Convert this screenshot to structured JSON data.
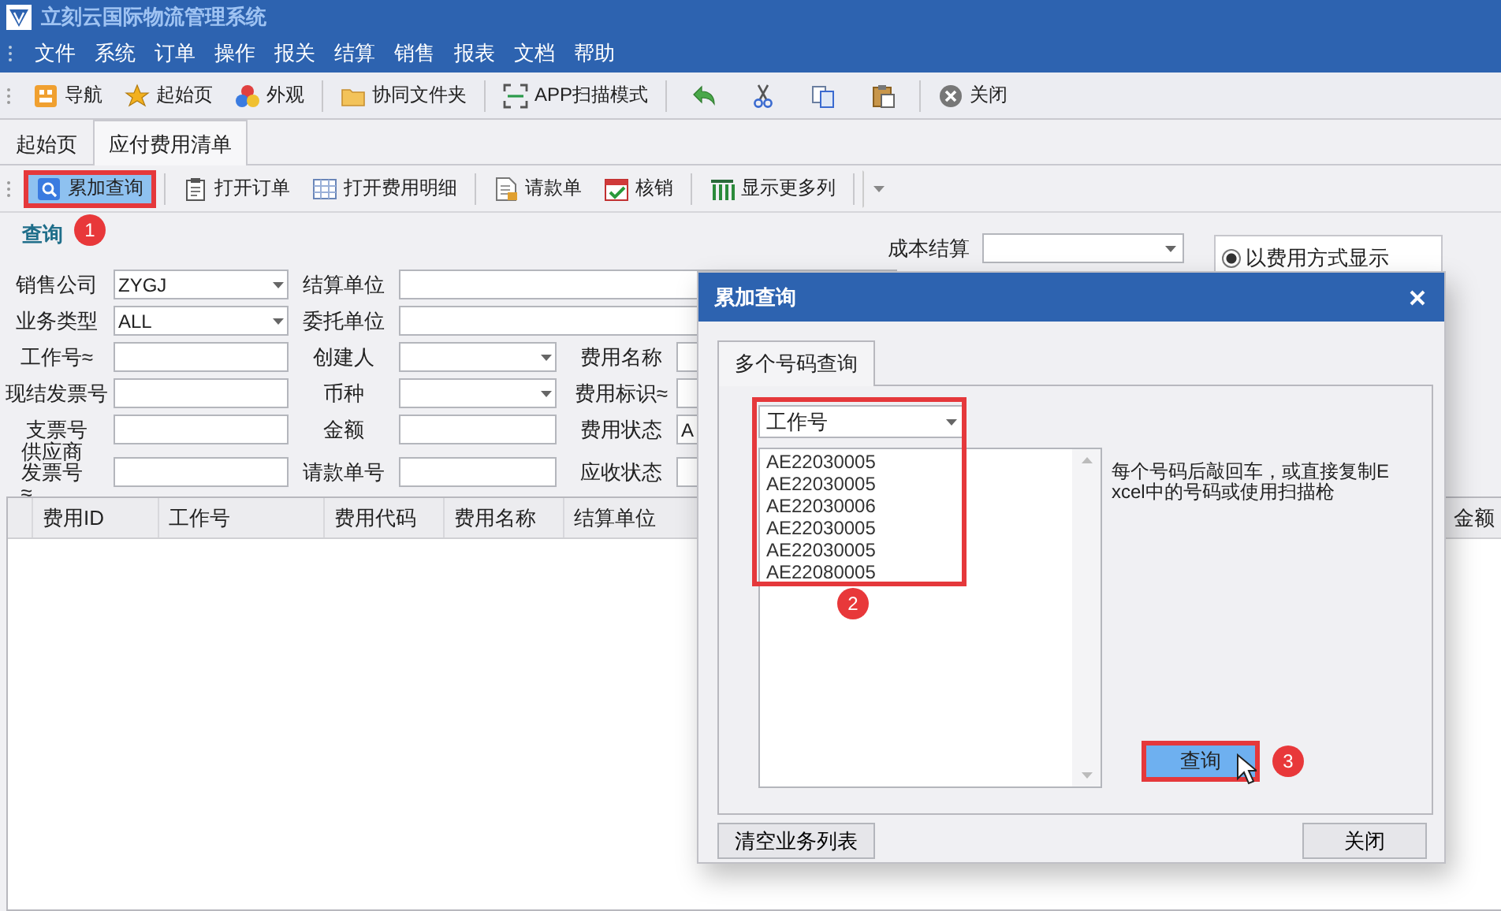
{
  "window": {
    "title": "立刻云国际物流管理系统"
  },
  "menu": [
    "文件",
    "系统",
    "订单",
    "操作",
    "报关",
    "结算",
    "销售",
    "报表",
    "文档",
    "帮助"
  ],
  "toolbar": [
    [
      {
        "kind": "labeled",
        "label": "导航"
      },
      {
        "kind": "labeled",
        "label": "起始页"
      },
      {
        "kind": "labeled",
        "label": "外观"
      }
    ],
    [
      {
        "kind": "labeled",
        "label": "协同文件夹"
      }
    ],
    [
      {
        "kind": "labeled",
        "label": "APP扫描模式"
      }
    ],
    [
      {
        "kind": "icon"
      },
      {
        "kind": "icon"
      },
      {
        "kind": "icon"
      },
      {
        "kind": "icon"
      }
    ],
    [
      {
        "kind": "labeled",
        "label": "关闭"
      }
    ]
  ],
  "tabs": [
    {
      "label": "起始页",
      "selected": false
    },
    {
      "label": "应付费用清单",
      "selected": true
    }
  ],
  "actions": [
    [
      {
        "kind": "labeled",
        "label": "累加查询",
        "highlighted": true,
        "badge": "1"
      }
    ],
    [
      {
        "kind": "labeled",
        "label": "打开订单",
        "highlighted": false
      },
      {
        "kind": "labeled",
        "label": "打开费用明细",
        "highlighted": false
      }
    ],
    [
      {
        "kind": "labeled",
        "label": "请款单",
        "highlighted": false
      },
      {
        "kind": "labeled",
        "label": "核销",
        "highlighted": false
      }
    ],
    [
      {
        "kind": "labeled",
        "label": "显示更多列",
        "highlighted": false
      }
    ],
    [
      {
        "kind": "menu"
      }
    ]
  ],
  "filter": {
    "title": "查询",
    "cost_settlement": {
      "label": "成本结算",
      "kind": "dropdown"
    },
    "display_mode": {
      "label": "以费用方式显示",
      "selected": true
    },
    "rows": [
      [
        {
          "label": "销售公司",
          "kind": "dropdown",
          "value": "ZYGJ"
        },
        {
          "label": "结算单位",
          "kind": "text"
        }
      ],
      [
        {
          "label": "业务类型",
          "kind": "dropdown",
          "value": "ALL"
        },
        {
          "label": "委托单位",
          "kind": "text"
        }
      ],
      [
        {
          "label": "工作号≈",
          "kind": "text"
        },
        {
          "label": "创建人",
          "kind": "dropdown"
        },
        {
          "label": "费用名称",
          "kind": "text"
        }
      ],
      [
        {
          "label": "现结发票号",
          "kind": "text"
        },
        {
          "label": "币种",
          "kind": "dropdown"
        },
        {
          "label": "费用标识≈",
          "kind": "text"
        }
      ],
      [
        {
          "label": "支票号",
          "kind": "text"
        },
        {
          "label": "金额",
          "kind": "text"
        },
        {
          "label": "费用状态",
          "kind": "text",
          "value": "A"
        }
      ],
      [
        {
          "label": "供应商发票号≈",
          "kind": "text"
        },
        {
          "label": "请款单号",
          "kind": "text"
        },
        {
          "label": "应收状态",
          "kind": "text"
        }
      ]
    ]
  },
  "table": {
    "columns": [
      "费用ID",
      "工作号",
      "费用代码",
      "费用名称",
      "结算单位",
      "金额"
    ]
  },
  "dialog": {
    "title": "累加查询",
    "tabs": [
      {
        "label": "多个号码查询",
        "selected": true
      }
    ],
    "lookup_field": {
      "value": "工作号",
      "outlined": true
    },
    "numbers": [
      "AE22030005",
      "AE22030005",
      "AE22030006",
      "AE22030005",
      "AE22030005",
      "AE22080005"
    ],
    "list_badge": "2",
    "hint": "每个号码后敲回车，或直接复制Excel中的号码或使用扫描枪",
    "query_button": {
      "label": "查询",
      "outlined": true,
      "badge": "3"
    },
    "buttons": [
      "清空业务列表",
      "关闭"
    ]
  }
}
